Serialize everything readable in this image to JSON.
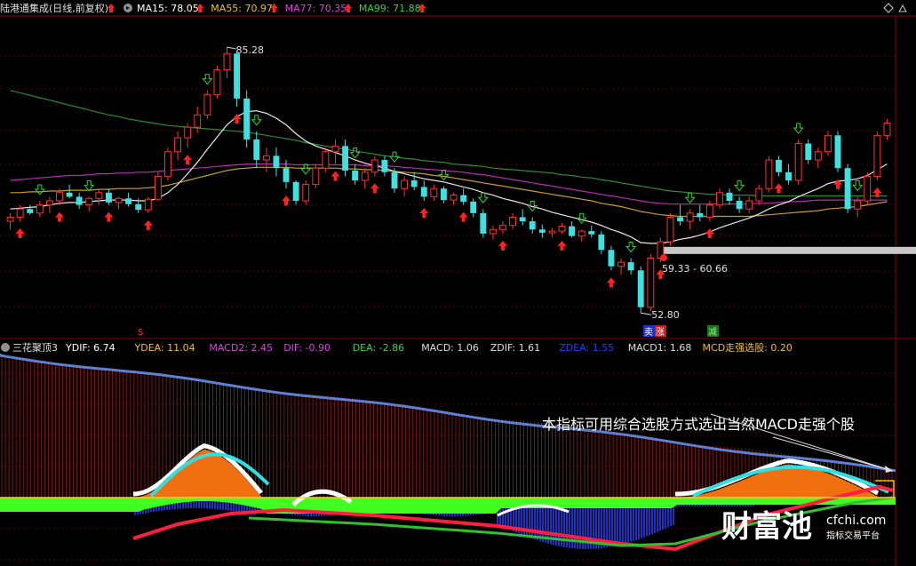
{
  "top_bar": {
    "title": "陆港通集成(日线,前复权)",
    "items": [
      {
        "label": "MA15: 78.05",
        "color": "#ffffff"
      },
      {
        "label": "MA55: 70.97",
        "color": "#f0c020"
      },
      {
        "label": "MA77: 70.35",
        "color": "#e040e0"
      },
      {
        "label": "MA99: 71.88",
        "color": "#40d040"
      }
    ]
  },
  "price_labels": {
    "high": "85.28",
    "low": "52.80",
    "range": "59.33 - 60.66"
  },
  "markers": {
    "s_label": "S",
    "sell_label": "卖",
    "rise_label": "涨",
    "reduce_label": "减"
  },
  "indicator_bar": {
    "name": "三花聚顶3",
    "items": [
      {
        "label": "YDIF: 6.74",
        "color": "#ffffff"
      },
      {
        "label": "YDEA: 11.04",
        "color": "#f0c020"
      },
      {
        "label": "MACD2: 2.45",
        "color": "#e040e0"
      },
      {
        "label": "DIF: -0.90",
        "color": "#e040e0"
      },
      {
        "label": "DEA: -2.86",
        "color": "#40d040"
      },
      {
        "label": "MACD: 1.06",
        "color": "#dddddd"
      },
      {
        "label": "ZDIF: 1.61",
        "color": "#dddddd"
      },
      {
        "label": "ZDEA: 1.55",
        "color": "#2040ff"
      },
      {
        "label": "MACD1: 1.68",
        "color": "#dddddd"
      },
      {
        "label": "MCD走强选股: 0.20",
        "color": "#f0c020"
      }
    ]
  },
  "annotation": "本指标可用综合选股方式选出当然MACD走强个股",
  "watermark": {
    "brand": "财富池",
    "domain": "cfchi.com",
    "tagline": "指标交易平台"
  },
  "chart_data": {
    "type": "candlestick",
    "y_range_price": [
      50,
      90
    ],
    "highlight_level": [
      59.33,
      60.66
    ],
    "candles": [
      [
        64,
        65,
        63,
        64.5
      ],
      [
        64.5,
        66,
        64,
        65.5
      ],
      [
        65.5,
        66,
        64.8,
        65
      ],
      [
        65,
        66.5,
        64.5,
        66
      ],
      [
        66,
        67,
        65,
        66.5
      ],
      [
        66.5,
        68,
        66,
        67.5
      ],
      [
        67.5,
        68.5,
        66.8,
        67
      ],
      [
        67,
        67.5,
        65.5,
        66
      ],
      [
        66,
        67,
        65.2,
        66.8
      ],
      [
        66.8,
        68,
        66,
        67.5
      ],
      [
        67.5,
        68,
        66,
        66.3
      ],
      [
        66.3,
        67,
        65.5,
        66.8
      ],
      [
        66.8,
        67.5,
        65.8,
        66.1
      ],
      [
        66.1,
        66.8,
        65,
        65.4
      ],
      [
        65.4,
        67,
        65,
        66.7
      ],
      [
        66.7,
        70,
        66.5,
        69.5
      ],
      [
        69.5,
        73,
        69,
        72.5
      ],
      [
        72.5,
        75,
        71.5,
        74.2
      ],
      [
        74.2,
        76,
        73,
        75.5
      ],
      [
        75.5,
        78,
        74.8,
        77
      ],
      [
        77,
        80,
        76.5,
        79.5
      ],
      [
        79.5,
        83,
        79,
        82.5
      ],
      [
        82.5,
        85.28,
        81.5,
        84.5
      ],
      [
        84.5,
        84.8,
        78,
        79
      ],
      [
        79,
        80,
        73,
        74
      ],
      [
        74,
        75,
        70.5,
        71.5
      ],
      [
        71.5,
        73,
        70,
        72
      ],
      [
        72,
        73,
        69.5,
        70.5
      ],
      [
        70.5,
        71.5,
        68,
        68.8
      ],
      [
        68.8,
        69,
        66,
        66.5
      ],
      [
        66.5,
        69,
        66,
        68.5
      ],
      [
        68.5,
        71,
        68,
        70.5
      ],
      [
        70.5,
        73,
        70,
        72.5
      ],
      [
        72.5,
        74,
        71,
        73.2
      ],
      [
        73.2,
        74,
        69.5,
        70.2
      ],
      [
        70.2,
        71,
        68.5,
        69
      ],
      [
        69,
        70.5,
        68,
        70
      ],
      [
        70,
        72,
        69.5,
        71.5
      ],
      [
        71.5,
        72,
        69.5,
        70
      ],
      [
        70,
        70.5,
        67.5,
        68
      ],
      [
        68,
        69.5,
        67,
        69
      ],
      [
        69,
        70,
        67.8,
        68.2
      ],
      [
        68.2,
        69,
        66.5,
        67
      ],
      [
        67,
        68.5,
        66.5,
        68
      ],
      [
        68,
        68.3,
        66.2,
        66.6
      ],
      [
        66.6,
        67.5,
        66,
        67.2
      ],
      [
        67.2,
        68,
        66,
        66.4
      ],
      [
        66.4,
        66.8,
        64.5,
        65
      ],
      [
        65,
        65.5,
        62,
        62.5
      ],
      [
        62.5,
        63.5,
        61.8,
        63
      ],
      [
        63,
        64,
        62.5,
        63.5
      ],
      [
        63.5,
        65,
        63,
        64.5
      ],
      [
        64.5,
        65.5,
        63.5,
        64
      ],
      [
        64,
        64.5,
        62.5,
        63
      ],
      [
        63,
        63.6,
        62,
        62.6
      ],
      [
        62.6,
        63.2,
        62,
        62.8
      ],
      [
        62.8,
        63.8,
        62.5,
        63.4
      ],
      [
        63.4,
        64,
        62,
        62.2
      ],
      [
        62.2,
        63,
        61.5,
        62.8
      ],
      [
        62.8,
        63.5,
        62,
        62.4
      ],
      [
        62.4,
        62.8,
        60,
        60.5
      ],
      [
        60.5,
        61,
        58,
        58.5
      ],
      [
        58.5,
        59.5,
        57.5,
        59
      ],
      [
        59,
        59.5,
        57.5,
        58
      ],
      [
        58,
        58.5,
        52.8,
        53.5
      ],
      [
        53.5,
        60,
        53,
        59.5
      ],
      [
        59.5,
        62,
        59,
        61.5
      ],
      [
        61.5,
        65,
        61,
        64.5
      ],
      [
        64.5,
        66,
        63.5,
        64
      ],
      [
        64,
        65.5,
        63,
        65
      ],
      [
        65,
        66,
        64,
        64.5
      ],
      [
        64.5,
        66.5,
        64,
        66
      ],
      [
        66,
        68,
        65.5,
        67.5
      ],
      [
        67.5,
        68,
        66,
        66.5
      ],
      [
        66.5,
        67,
        65,
        65.5
      ],
      [
        65.5,
        67,
        65,
        66.5
      ],
      [
        66.5,
        68.5,
        66,
        68
      ],
      [
        68,
        72,
        67.5,
        71.5
      ],
      [
        71.5,
        72,
        69.5,
        70
      ],
      [
        70,
        71,
        68.5,
        69
      ],
      [
        69,
        74,
        68.5,
        73.5
      ],
      [
        73.5,
        74,
        71,
        71.5
      ],
      [
        71.5,
        73,
        70.5,
        72.5
      ],
      [
        72.5,
        75,
        72,
        74.5
      ],
      [
        74.5,
        75,
        70,
        70.5
      ],
      [
        70.5,
        71,
        65,
        65.5
      ],
      [
        65.5,
        67,
        64.5,
        66.5
      ],
      [
        66.5,
        70,
        66,
        69.5
      ],
      [
        69.5,
        75,
        69,
        74.5
      ],
      [
        74.5,
        76.5,
        74,
        76
      ]
    ],
    "ma15": [
      65.5,
      65.6,
      65.7,
      65.8,
      66,
      66.2,
      66.3,
      66.3,
      66.4,
      66.5,
      66.6,
      66.6,
      66.6,
      66.5,
      66.5,
      66.8,
      67.5,
      68.5,
      69.8,
      71.2,
      72.8,
      74.3,
      75.8,
      76.8,
      77.4,
      77.5,
      77.2,
      76.6,
      75.8,
      74.7,
      73.8,
      73.2,
      72.8,
      72.4,
      72,
      71.5,
      71.1,
      70.8,
      70.5,
      70.1,
      69.8,
      69.5,
      69.2,
      69,
      68.8,
      68.5,
      68.2,
      67.9,
      67.5,
      67.2,
      66.8,
      66.5,
      66.2,
      65.8,
      65.5,
      65.1,
      64.8,
      64.5,
      64.2,
      63.9,
      63.5,
      63,
      62.6,
      62.1,
      61.4,
      61.3,
      61.3,
      61.5,
      61.8,
      62,
      62.3,
      62.7,
      63.2,
      63.6,
      64,
      64.4,
      64.9,
      65.5,
      66,
      66.4,
      67,
      67.5,
      68,
      68.6,
      68.9,
      69,
      69.2,
      69.6,
      70.3,
      71
    ],
    "ma55": [
      67.5,
      67.5,
      67.6,
      67.6,
      67.7,
      67.7,
      67.8,
      67.8,
      67.8,
      67.9,
      67.9,
      68,
      68,
      68,
      68.1,
      68.2,
      68.4,
      68.7,
      69,
      69.3,
      69.6,
      69.9,
      70.2,
      70.4,
      70.5,
      70.6,
      70.6,
      70.6,
      70.6,
      70.5,
      70.5,
      70.5,
      70.5,
      70.5,
      70.4,
      70.4,
      70.3,
      70.3,
      70.2,
      70.1,
      70,
      69.9,
      69.8,
      69.6,
      69.5,
      69.3,
      69.1,
      68.9,
      68.7,
      68.5,
      68.3,
      68.1,
      67.9,
      67.7,
      67.5,
      67.3,
      67.1,
      66.9,
      66.7,
      66.5,
      66.2,
      66,
      65.8,
      65.5,
      65.2,
      65,
      64.8,
      64.7,
      64.6,
      64.6,
      64.6,
      64.6,
      64.6,
      64.6,
      64.6,
      64.6,
      64.7,
      64.8,
      64.9,
      65,
      65.1,
      65.2,
      65.3,
      65.5,
      65.6,
      65.7,
      65.8,
      66,
      66.2,
      66.4
    ],
    "ma77": [
      69,
      69.1,
      69.2,
      69.3,
      69.4,
      69.5,
      69.6,
      69.6,
      69.7,
      69.8,
      69.8,
      69.9,
      69.9,
      70,
      70,
      70.1,
      70.2,
      70.3,
      70.4,
      70.5,
      70.6,
      70.7,
      70.8,
      70.9,
      71,
      71,
      71,
      71,
      71,
      70.9,
      70.9,
      70.9,
      70.9,
      70.9,
      70.9,
      70.9,
      70.8,
      70.8,
      70.8,
      70.7,
      70.6,
      70.5,
      70.4,
      70.3,
      70.2,
      70.1,
      70,
      69.8,
      69.7,
      69.5,
      69.3,
      69.1,
      68.9,
      68.7,
      68.5,
      68.3,
      68.1,
      67.9,
      67.7,
      67.5,
      67.3,
      67.1,
      66.9,
      66.7,
      66.5,
      66.3,
      66.2,
      66.1,
      66.1,
      66.1,
      66.1,
      66.1,
      66.1,
      66.1,
      66.1,
      66.1,
      66.2,
      66.2,
      66.3,
      66.4,
      66.4,
      66.5,
      66.6,
      66.6,
      66.6,
      66.6,
      66.6,
      66.6,
      66.6,
      66.6
    ],
    "ma99": [
      80,
      79.7,
      79.4,
      79.1,
      78.8,
      78.5,
      78.2,
      77.9,
      77.6,
      77.3,
      77,
      76.8,
      76.5,
      76.3,
      76.1,
      75.9,
      75.7,
      75.6,
      75.5,
      75.4,
      75.3,
      75.2,
      75.1,
      75,
      74.9,
      74.7,
      74.5,
      74.3,
      74.1,
      73.9,
      73.6,
      73.4,
      73.2,
      73,
      72.8,
      72.6,
      72.4,
      72.2,
      72,
      71.9,
      71.7,
      71.6,
      71.4,
      71.3,
      71.2,
      71,
      70.9,
      70.8,
      70.7,
      70.5,
      70.4,
      70.3,
      70.2,
      70.1,
      70,
      69.9,
      69.7,
      69.6,
      69.4,
      69.3,
      69.1,
      68.9,
      68.7,
      68.5,
      68.3,
      68.1,
      67.9,
      67.7,
      67.6,
      67.5,
      67.4,
      67.3,
      67.3,
      67.2,
      67.2,
      67.2,
      67.1,
      67.1,
      67.1,
      67.1,
      67.1,
      67.1,
      67.1,
      67.1,
      67.1,
      67.1,
      67.1,
      67.1,
      67.1,
      67.1
    ]
  }
}
